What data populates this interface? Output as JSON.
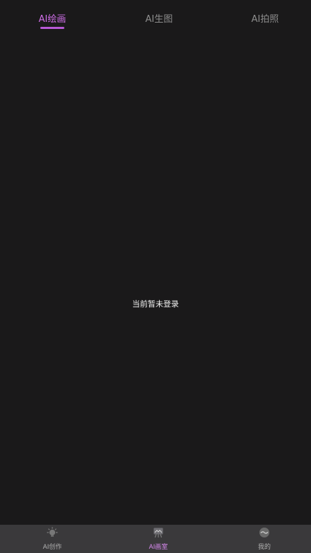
{
  "top_tabs": [
    {
      "label": "AI绘画",
      "active": true
    },
    {
      "label": "AI生图",
      "active": false
    },
    {
      "label": "AI拍照",
      "active": false
    }
  ],
  "empty_state": {
    "message": "当前暂未登录"
  },
  "bottom_nav": {
    "items": [
      {
        "label": "AI创作",
        "icon": "lightbulb-icon",
        "active": false
      },
      {
        "label": "AI画室",
        "icon": "easel-icon",
        "active": true
      },
      {
        "label": "我的",
        "icon": "profile-icon",
        "active": false
      }
    ]
  },
  "colors": {
    "background": "#1a191a",
    "accent": "#cf6ee8",
    "tab_inactive": "#8d8d8d",
    "bottom_nav": "#3a393b"
  }
}
